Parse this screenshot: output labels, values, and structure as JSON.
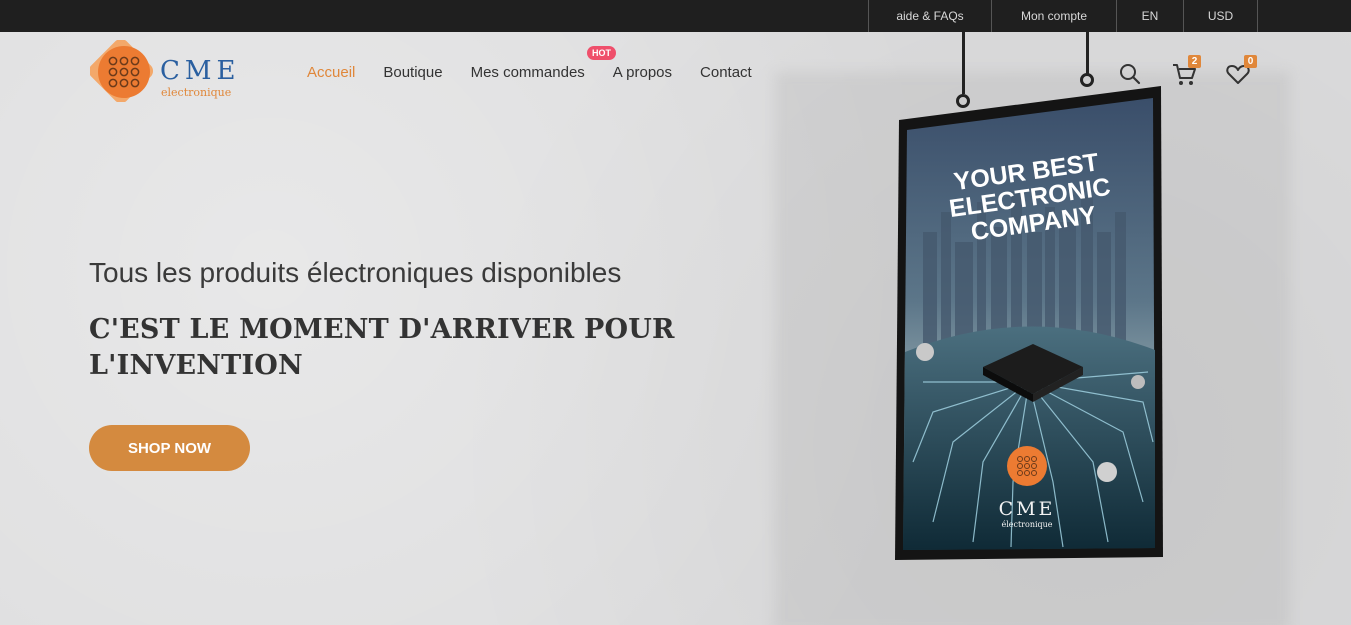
{
  "topbar": {
    "links": [
      "aide & FAQs",
      "Mon compte",
      "EN",
      "USD"
    ]
  },
  "logo": {
    "brand": "CME",
    "sub": "electronique"
  },
  "nav": {
    "items": [
      "Accueil",
      "Boutique",
      "Mes commandes",
      "A propos",
      "Contact"
    ],
    "hot_badge": "HOT"
  },
  "header_icons": {
    "search": "search-icon",
    "cart": "cart-icon",
    "wishlist": "heart-icon",
    "cart_count": "2",
    "wishlist_count": "0"
  },
  "hero": {
    "subtitle": "Tous les produits électroniques disponibles",
    "headline": "C'EST LE MOMENT D'ARRIVER POUR L'INVENTION",
    "cta": "SHOP NOW"
  },
  "poster": {
    "line1": "YOUR BEST",
    "line2": "ELECTRONIC",
    "line3": "COMPANY",
    "brand": "CME",
    "sub": "électronique"
  },
  "colors": {
    "accent": "#e0873a",
    "topbar": "#1f1f1f",
    "hot": "#ef4f6b",
    "cta": "#d48a3f",
    "brand_blue": "#2a5fa0"
  }
}
